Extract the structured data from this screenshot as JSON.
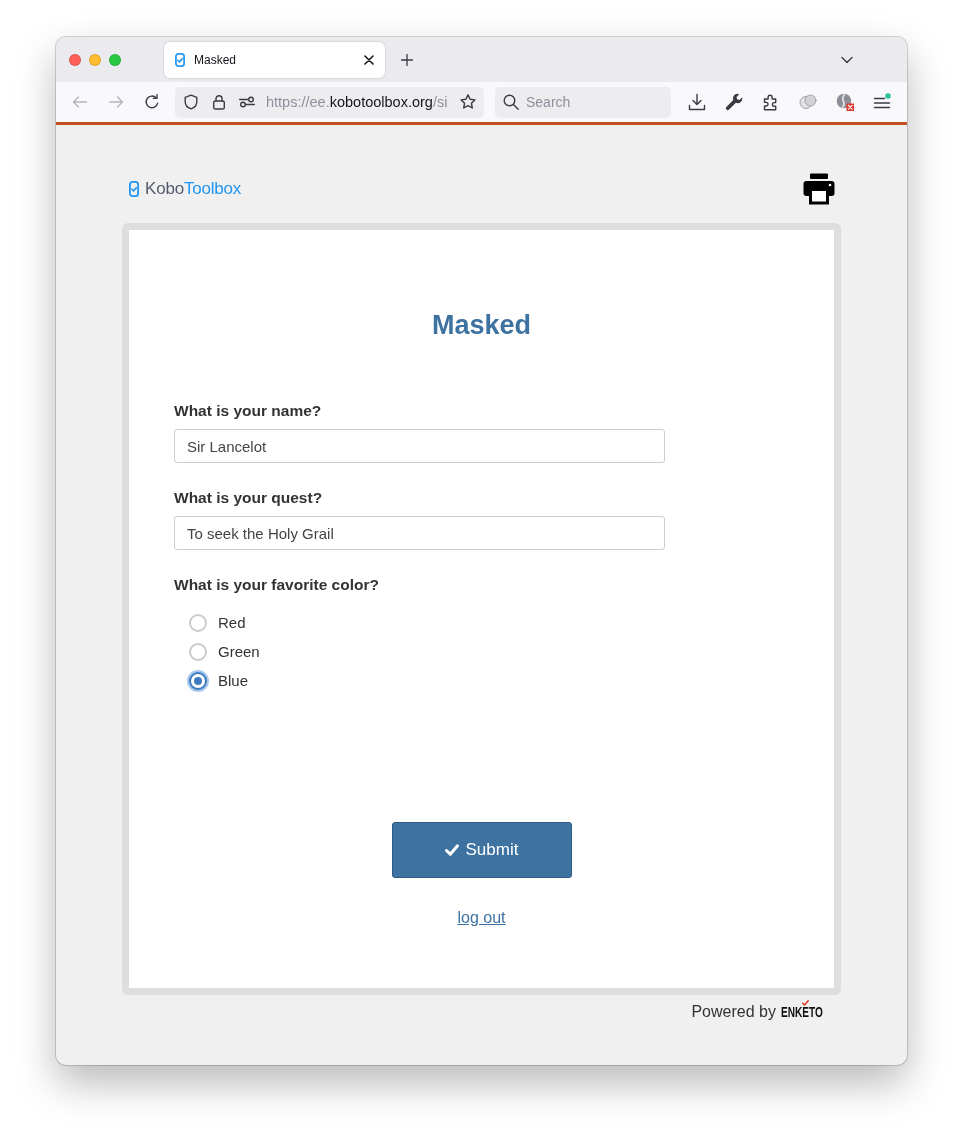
{
  "browser": {
    "tabs": [
      {
        "title": "Masked",
        "selected": true
      }
    ],
    "toolbar": {
      "back": {
        "disabled": true
      },
      "forward": {
        "disabled": true
      },
      "menu": {
        "badge": true
      }
    },
    "address": {
      "scheme": "https://ee.",
      "host": "kobotoolbox.org",
      "path": "/si"
    },
    "search": {
      "placeholder": "Search"
    }
  },
  "header": {
    "logo": {
      "first": "Kobo",
      "second": "Toolbox"
    }
  },
  "form": {
    "title": "Masked",
    "questions": [
      {
        "kind": "text",
        "label": "What is your name?",
        "value": "Sir Lancelot"
      },
      {
        "kind": "text",
        "label": "What is your quest?",
        "value": "To seek the Holy Grail"
      },
      {
        "kind": "radio",
        "label": "What is your favorite color?",
        "options": [
          {
            "label": "Red",
            "selected": false
          },
          {
            "label": "Green",
            "selected": false
          },
          {
            "label": "Blue",
            "selected": true
          }
        ]
      }
    ],
    "submit": "Submit",
    "logout": "log out"
  },
  "footer": {
    "powered_by": "Powered by",
    "brand": "ENKETO"
  }
}
